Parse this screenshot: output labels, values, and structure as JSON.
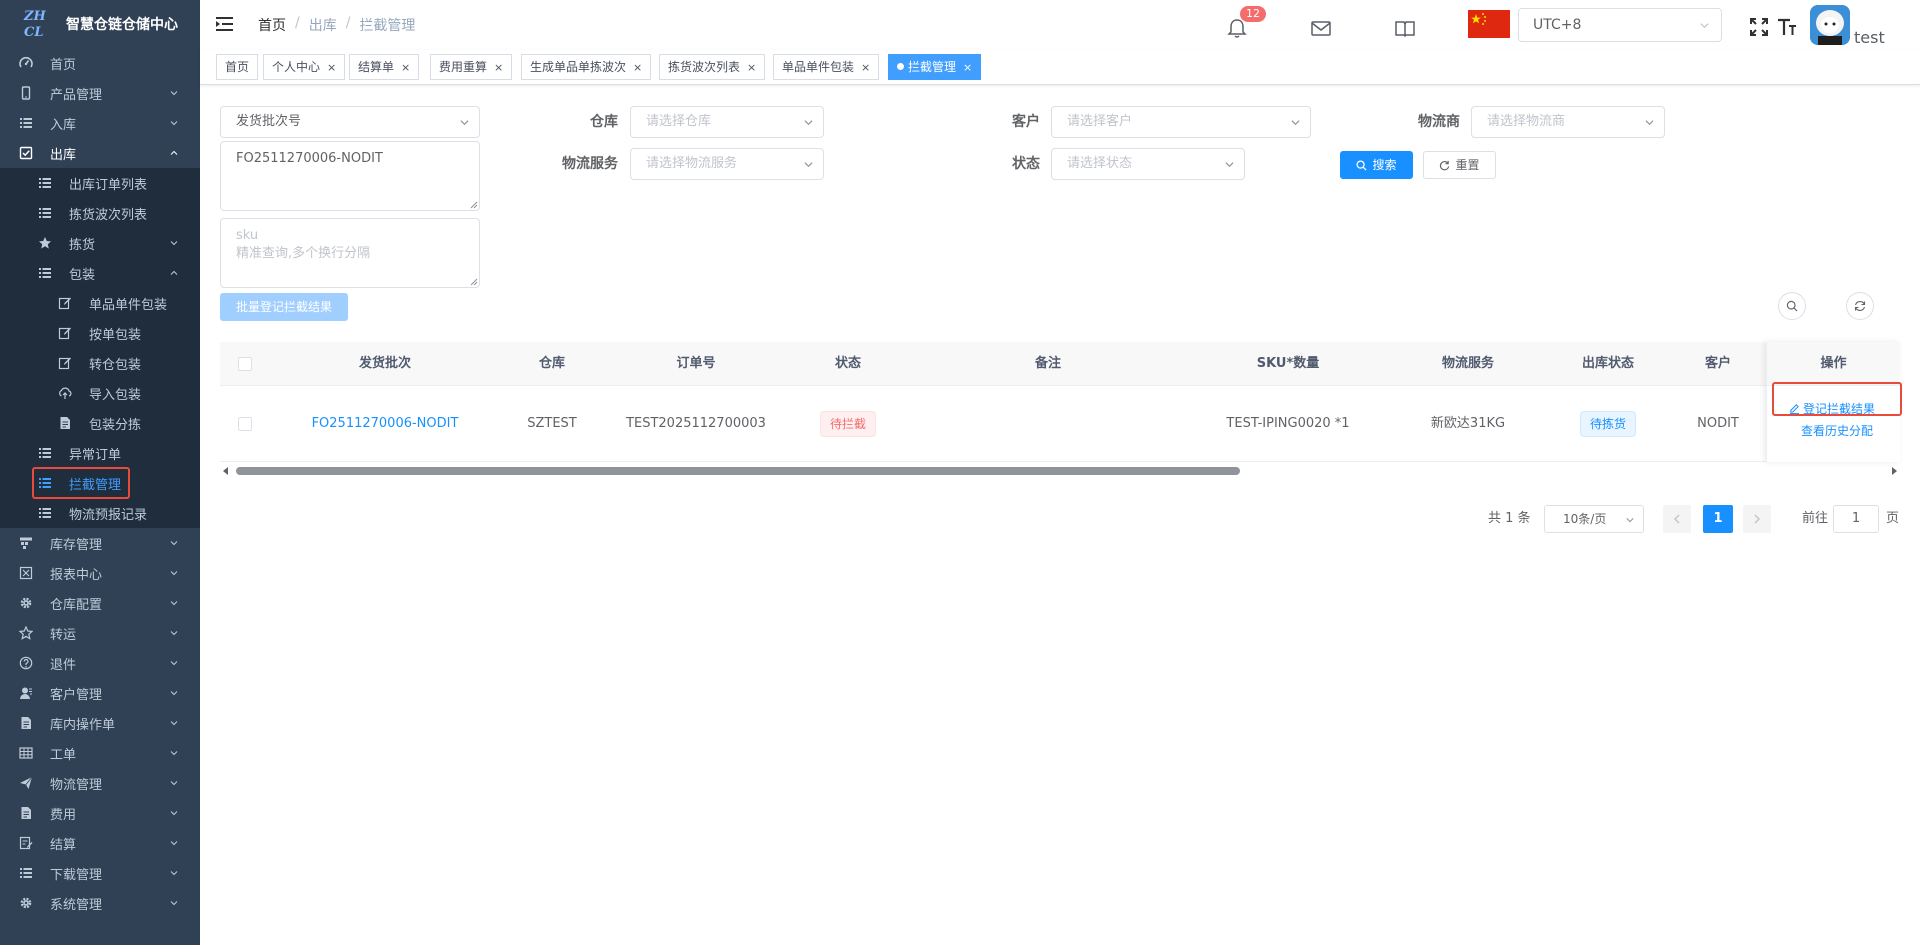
{
  "logo": {
    "mark": "ZHCL",
    "title": "智慧仓链仓储中心"
  },
  "sidebar": {
    "items": [
      {
        "label": "首页",
        "icon": "dashboard-icon",
        "level": 1
      },
      {
        "label": "产品管理",
        "icon": "phone-icon",
        "level": 1,
        "arrow": "down"
      },
      {
        "label": "入库",
        "icon": "list-icon",
        "level": 1,
        "arrow": "down"
      },
      {
        "label": "出库",
        "icon": "checkbox-icon",
        "level": 1,
        "arrow": "up",
        "open": true
      },
      {
        "label": "出库订单列表",
        "icon": "list-icon",
        "level": 2
      },
      {
        "label": "拣货波次列表",
        "icon": "list-icon",
        "level": 2
      },
      {
        "label": "拣货",
        "icon": "star-icon",
        "level": 2,
        "arrow": "down"
      },
      {
        "label": "包装",
        "icon": "list-icon",
        "level": 2,
        "arrow": "up"
      },
      {
        "label": "单品单件包装",
        "icon": "edit-icon",
        "level": 3
      },
      {
        "label": "按单包装",
        "icon": "edit-icon",
        "level": 3
      },
      {
        "label": "转仓包装",
        "icon": "edit-icon",
        "level": 3
      },
      {
        "label": "导入包装",
        "icon": "upload-icon",
        "level": 3
      },
      {
        "label": "包装分拣",
        "icon": "document-icon",
        "level": 3
      },
      {
        "label": "异常订单",
        "icon": "list-icon",
        "level": 2
      },
      {
        "label": "拦截管理",
        "icon": "list-icon",
        "level": 2,
        "active": true
      },
      {
        "label": "物流预报记录",
        "icon": "list-icon",
        "level": 2
      },
      {
        "label": "库存管理",
        "icon": "warehouse-icon",
        "level": 1,
        "arrow": "down"
      },
      {
        "label": "报表中心",
        "icon": "report-icon",
        "level": 1,
        "arrow": "down"
      },
      {
        "label": "仓库配置",
        "icon": "gear-icon",
        "level": 1,
        "arrow": "down"
      },
      {
        "label": "转运",
        "icon": "star-outline-icon",
        "level": 1,
        "arrow": "down"
      },
      {
        "label": "退件",
        "icon": "question-icon",
        "level": 1,
        "arrow": "down"
      },
      {
        "label": "客户管理",
        "icon": "user-icon",
        "level": 1,
        "arrow": "down"
      },
      {
        "label": "库内操作单",
        "icon": "document-icon",
        "level": 1,
        "arrow": "down"
      },
      {
        "label": "工单",
        "icon": "table-icon",
        "level": 1,
        "arrow": "down"
      },
      {
        "label": "物流管理",
        "icon": "send-icon",
        "level": 1,
        "arrow": "down"
      },
      {
        "label": "费用",
        "icon": "document-icon",
        "level": 1,
        "arrow": "down"
      },
      {
        "label": "结算",
        "icon": "edit-doc-icon",
        "level": 1,
        "arrow": "down"
      },
      {
        "label": "下载管理",
        "icon": "list-icon",
        "level": 1,
        "arrow": "down"
      },
      {
        "label": "系统管理",
        "icon": "gear-icon",
        "level": 1,
        "arrow": "down"
      }
    ]
  },
  "header": {
    "breadcrumb": [
      "首页",
      "出库",
      "拦截管理"
    ],
    "notify_count": "12",
    "timezone": "UTC+8",
    "username": "test"
  },
  "tags": [
    {
      "label": "首页",
      "closable": false
    },
    {
      "label": "个人中心",
      "closable": true
    },
    {
      "label": "结算单",
      "closable": true
    },
    {
      "label": "费用重算",
      "closable": true
    },
    {
      "label": "生成单品单拣波次",
      "closable": true
    },
    {
      "label": "拣货波次列表",
      "closable": true
    },
    {
      "label": "单品单件包装",
      "closable": true
    },
    {
      "label": "拦截管理",
      "closable": true,
      "active": true
    }
  ],
  "filters": {
    "batch_type": "发货批次号",
    "batch_value": "FO2511270006-NODIT",
    "sku_label": "sku",
    "sku_placeholder": "精准查询,多个换行分隔",
    "warehouse_label": "仓库",
    "warehouse_placeholder": "请选择仓库",
    "customer_label": "客户",
    "customer_placeholder": "请选择客户",
    "carrier_label": "物流商",
    "carrier_placeholder": "请选择物流商",
    "service_label": "物流服务",
    "service_placeholder": "请选择物流服务",
    "status_label": "状态",
    "status_placeholder": "请选择状态",
    "search_label": "搜索",
    "reset_label": "重置",
    "batch_register_label": "批量登记拦截结果"
  },
  "table": {
    "columns": [
      "发货批次",
      "仓库",
      "订单号",
      "状态",
      "备注",
      "SKU*数量",
      "物流服务",
      "出库状态",
      "客户",
      "操作"
    ],
    "rows": [
      {
        "batch": "FO2511270006-NODIT",
        "warehouse": "SZTEST",
        "order_no": "TEST2025112700003",
        "status": "待拦截",
        "remark": "",
        "sku_qty": "TEST-IPING0020 *1",
        "service": "新欧达31KG",
        "out_status": "待拣货",
        "customer": "NODIT",
        "action_register": "登记拦截结果",
        "action_history": "查看历史分配"
      }
    ]
  },
  "pagination": {
    "total": "共 1 条",
    "page_size": "10条/页",
    "current": "1",
    "goto_label": "前往",
    "goto_value": "1",
    "page_suffix": "页"
  },
  "colors": {
    "sidebar_bg": "#304156",
    "primary": "#1890ff",
    "active_menu": "#409eff",
    "highlight": "#e84a3c"
  }
}
